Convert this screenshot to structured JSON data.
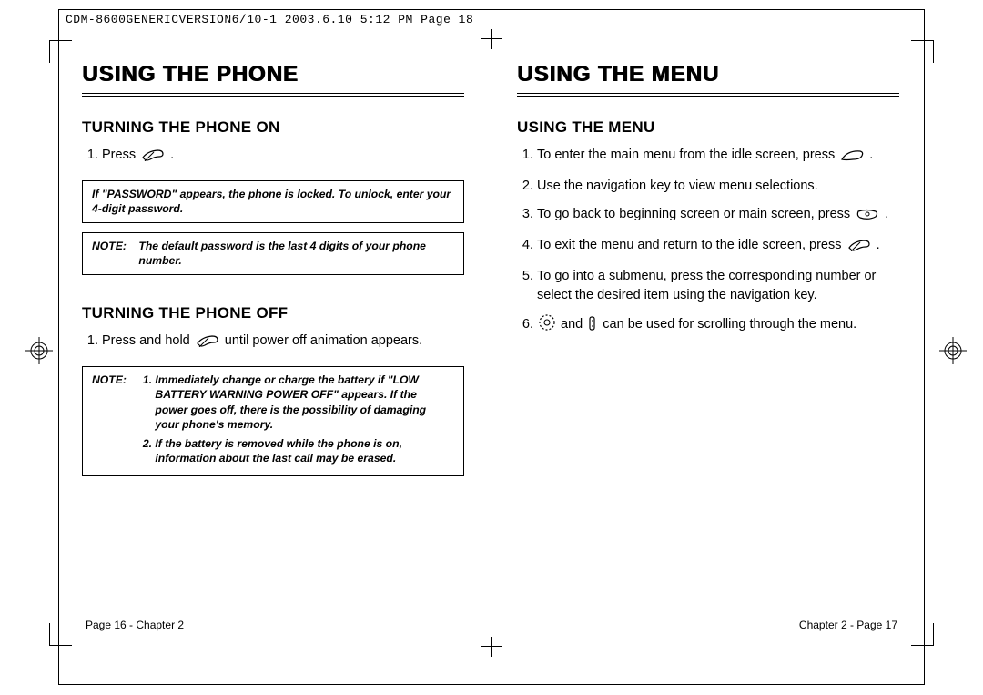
{
  "meta_header": "CDM-8600GENERICVERSION6/10-1  2003.6.10  5:12 PM  Page 18",
  "left": {
    "chapter": "USING THE PHONE",
    "sec1_title": "TURNING THE PHONE ON",
    "sec1_step1_a": "Press ",
    "sec1_step1_b": ".",
    "note1": "If \"PASSWORD\" appears, the phone is locked. To unlock, enter your 4-digit password.",
    "note2_label": "NOTE:",
    "note2": "The default password is the last 4 digits of your phone number.",
    "sec2_title": "TURNING THE PHONE OFF",
    "sec2_step1_a": "Press and hold ",
    "sec2_step1_b": " until power off animation appears.",
    "note3_label": "NOTE:",
    "note3_item1": "Immediately change or charge the battery if \"LOW BATTERY WARNING POWER OFF\" appears. If the power goes off, there is the possibility of damaging your phone's memory.",
    "note3_item2": "If the battery is removed while the phone is on, information about the last call may be erased.",
    "footer": "Page 16 - Chapter 2"
  },
  "right": {
    "chapter": "USING THE MENU",
    "sec1_title": "USING THE MENU",
    "s1_a": "To enter the main menu from the idle screen, press",
    "s1_b": " .",
    "s2": "Use the navigation key to view menu selections.",
    "s3_a": "To go back to beginning screen or main screen, press ",
    "s3_b": " .",
    "s4_a": "To exit the menu and return to the idle screen, press ",
    "s4_b": " .",
    "s5": "To go into a submenu, press the corresponding number or select the desired item using the navigation key.",
    "s6_a": "",
    "s6_b": " and ",
    "s6_c": " can be used for scrolling through the menu.",
    "footer": "Chapter 2 - Page 17"
  }
}
